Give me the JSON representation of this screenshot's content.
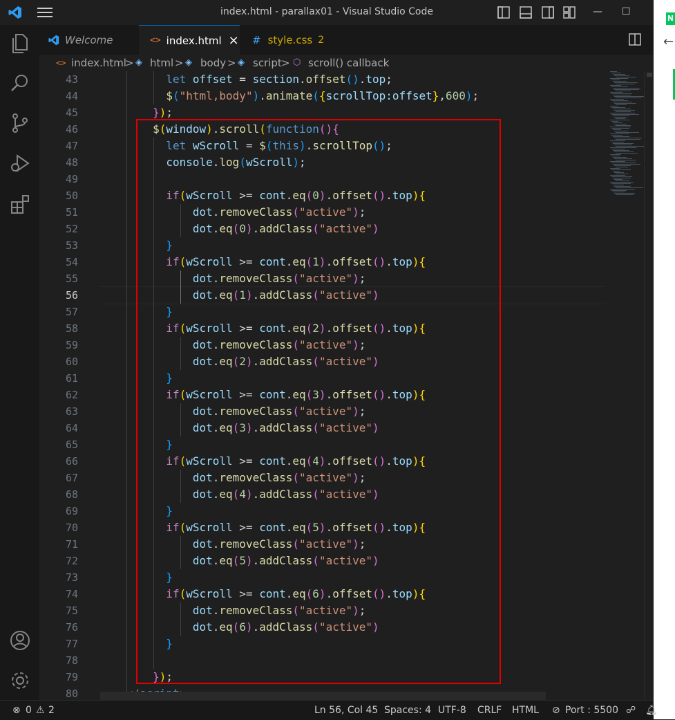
{
  "window": {
    "title": "index.html - parallax01 - Visual Studio Code",
    "controls": {
      "minimize": "—",
      "maximize": "☐"
    }
  },
  "tabs": [
    {
      "label": "Welcome",
      "icon": "vscode-logo-icon"
    },
    {
      "label": "index.html",
      "icon": "html-file-icon",
      "close": "×"
    },
    {
      "label": "style.css",
      "icon": "css-hash-icon",
      "badge": "2"
    }
  ],
  "breadcrumb": {
    "sep": ">",
    "items": [
      "index.html",
      "html",
      "body",
      "script",
      "scroll() callback"
    ]
  },
  "editor": {
    "line_numbers": [
      "43",
      "44",
      "45",
      "46",
      "47",
      "48",
      "49",
      "50",
      "51",
      "52",
      "53",
      "54",
      "55",
      "56",
      "57",
      "58",
      "59",
      "60",
      "61",
      "62",
      "63",
      "64",
      "65",
      "66",
      "67",
      "68",
      "69",
      "70",
      "71",
      "72",
      "73",
      "74",
      "75",
      "76",
      "77",
      "78",
      "79",
      "80"
    ],
    "current_line": "56",
    "code": {
      "l43": {
        "a": "let",
        "b": "offset",
        "c": " = ",
        "d": "section",
        "e": ".",
        "f": "offset",
        "g": "()",
        "h": ".",
        "i": "top",
        "j": ";"
      },
      "l44": {
        "a": "$",
        "b": "(",
        "c": "\"html,body\"",
        "d": ")",
        "e": ".",
        "f": "animate",
        "g": "(",
        "h": "{",
        "i": "scrollTop",
        "j": ":",
        "k": "offset",
        "l": "}",
        "m": ",",
        "n": "600",
        "o": ")",
        "p": ";"
      },
      "l45": {
        "a": "}",
        "b": ")",
        "c": ";"
      },
      "l46": {
        "a": "$",
        "b": "(",
        "c": "window",
        "d": ")",
        "e": ".",
        "f": "scroll",
        "g": "(",
        "h": "function",
        "i": "()",
        "j": "{"
      },
      "l47": {
        "a": "let",
        "b": "wScroll",
        "c": " = ",
        "d": "$",
        "e": "(",
        "f": "this",
        "g": ")",
        "h": ".",
        "i": "scrollTop",
        "j": "()",
        "k": ";"
      },
      "l48": {
        "a": "console",
        "b": ".",
        "c": "log",
        "d": "(",
        "e": "wScroll",
        "f": ")",
        "g": ";"
      },
      "if_blocks": [
        {
          "n": "0"
        },
        {
          "n": "1"
        },
        {
          "n": "2"
        },
        {
          "n": "3"
        },
        {
          "n": "4"
        },
        {
          "n": "5"
        },
        {
          "n": "6"
        }
      ],
      "tokens": {
        "if": "if",
        "paren_open": "(",
        "wscroll": "wScroll",
        "gte": " >= ",
        "cont": "cont",
        "dot": ".",
        "eq": "eq",
        "offset": "offset",
        "call": "()",
        "top": "top",
        "paren_close": ")",
        "brace_open": "{",
        "brace_close": "}",
        "var_dot": "dot",
        "removeClass": "removeClass",
        "addClass": "addClass",
        "active": "\"active\"",
        "semi": ";"
      },
      "l79": {
        "a": "}",
        "b": ")",
        "c": ";"
      },
      "l80": {
        "a": "</",
        "b": "script",
        "c": ">"
      }
    }
  },
  "statusbar": {
    "errors": "0",
    "warnings": "2",
    "position": "Ln 56, Col 45",
    "spaces": "Spaces: 4",
    "encoding": "UTF-8",
    "eol": "CRLF",
    "language": "HTML",
    "port": "Port : 5500"
  },
  "colors": {
    "accent": "#0078d4",
    "highlight_box": "#e00000",
    "background": "#1f1f1f"
  }
}
